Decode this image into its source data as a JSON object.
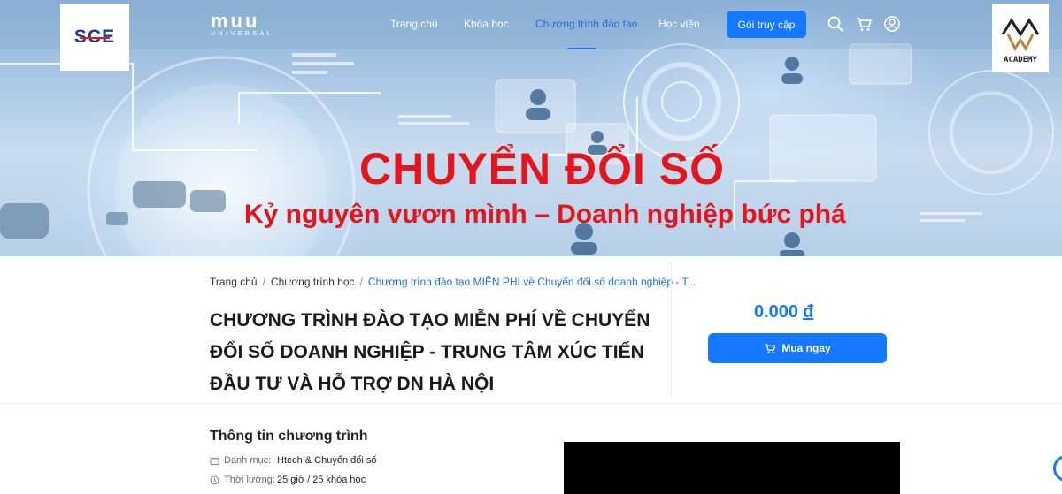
{
  "logos": {
    "left_text": "SCE",
    "right_text": "ACADEMY"
  },
  "brand": {
    "name": "muu",
    "sub": "UNIVERSAL"
  },
  "nav": {
    "items": [
      {
        "label": "Trang chủ",
        "active": false
      },
      {
        "label": "Khóa học",
        "active": false
      },
      {
        "label": "Chương trình đào tạo",
        "active": true
      },
      {
        "label": "Học viện",
        "active": false
      }
    ],
    "cta_label": "Gói truy cập",
    "icons": [
      "search-icon",
      "cart-icon",
      "user-icon"
    ]
  },
  "hero": {
    "title": "CHUYỂN ĐỔI SỐ",
    "subtitle": "Kỷ nguyên vươn mình – Doanh nghiệp bức phá"
  },
  "breadcrumb": {
    "items": [
      "Trang chủ",
      "Chương trình học"
    ],
    "current": "Chương trình đào tạo MIỄN PHÍ về Chuyển đổi số doanh nghiệp - T..."
  },
  "page_title": "CHƯƠNG TRÌNH ĐÀO TẠO MIỄN PHÍ VỀ CHUYỂN ĐỔI SỐ DOANH NGHIỆP - TRUNG TÂM XÚC TIẾN ĐẦU TƯ VÀ HỖ TRỢ DN HÀ NỘI",
  "purchase": {
    "price": "0.000",
    "currency": "đ",
    "buy_label": "Mua ngay"
  },
  "info": {
    "title": "Thông tin chương trình",
    "rows": [
      {
        "icon": "folder-icon",
        "label": "Danh mục:",
        "value": "Htech & Chuyển đổi số"
      },
      {
        "icon": "clock-icon",
        "label": "Thời lượng:",
        "value": "25 giờ / 25 khóa học"
      }
    ]
  },
  "colors": {
    "accent": "#1677ff",
    "hero_text": "#e4161d"
  }
}
